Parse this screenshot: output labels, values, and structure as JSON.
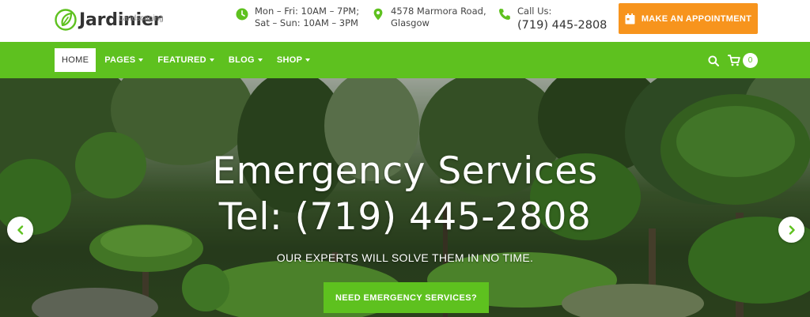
{
  "brand": {
    "name": "Jardinier",
    "tagline": "Landscaping",
    "accent_color": "#5ec11f",
    "orange_color": "#f7941d"
  },
  "header": {
    "hours": {
      "icon": "clock-icon",
      "line1": "Mon – Fri: 10AM – 7PM;",
      "line2": "Sat – Sun: 10AM – 3PM"
    },
    "address": {
      "icon": "map-pin-icon",
      "line1": "4578 Marmora Road,",
      "line2": "Glasgow"
    },
    "call": {
      "icon": "phone-icon",
      "label": "Call Us:",
      "number": "(719) 445-2808"
    },
    "appointment_button": {
      "icon": "calendar-icon",
      "label": "MAKE AN APPOINTMENT"
    }
  },
  "nav": {
    "items": [
      {
        "label": "HOME",
        "active": true,
        "dropdown": false
      },
      {
        "label": "PAGES",
        "active": false,
        "dropdown": true
      },
      {
        "label": "FEATURED",
        "active": false,
        "dropdown": true
      },
      {
        "label": "BLOG",
        "active": false,
        "dropdown": true
      },
      {
        "label": "SHOP",
        "active": false,
        "dropdown": true
      }
    ],
    "search_icon": "search-icon",
    "cart_icon": "cart-icon",
    "cart_count": "0"
  },
  "hero": {
    "title_line1": "Emergency Services",
    "title_line2": "Tel: (719) 445-2808",
    "subtitle": "OUR EXPERTS WILL SOLVE THEM IN NO TIME.",
    "button_label": "NEED EMERGENCY SERVICES?",
    "prev_icon": "chevron-left-icon",
    "next_icon": "chevron-right-icon"
  }
}
